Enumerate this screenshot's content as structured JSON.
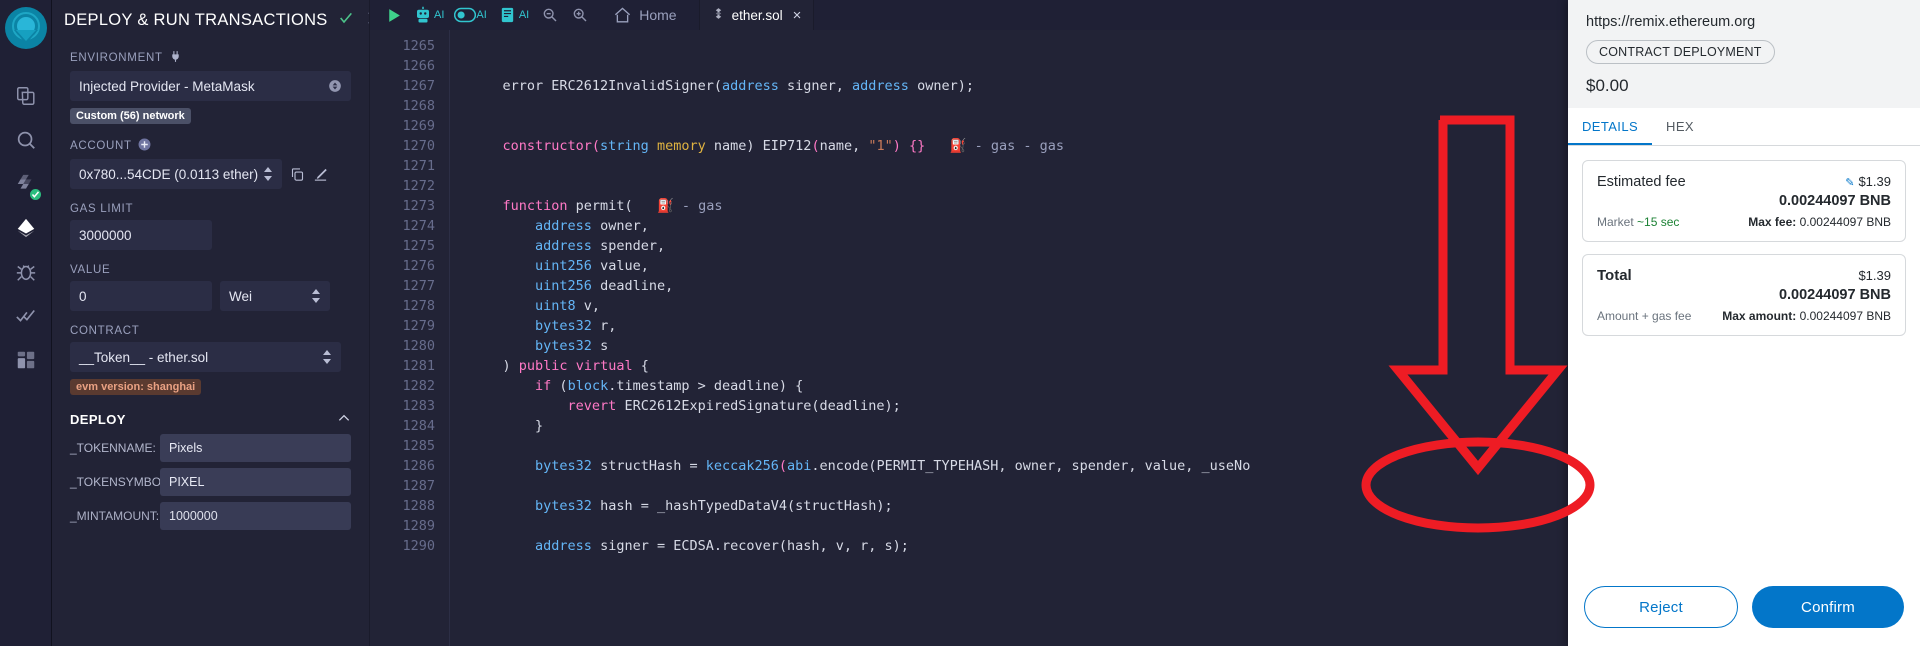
{
  "iconbar": {
    "items": [
      {
        "name": "remix-logo",
        "label": "Remix"
      },
      {
        "name": "file-explorer-icon",
        "label": "File explorer"
      },
      {
        "name": "search-icon",
        "label": "Search in files"
      },
      {
        "name": "solidity-compiler-icon",
        "label": "Solidity compiler"
      },
      {
        "name": "deploy-run-icon",
        "label": "Deploy & run transactions"
      },
      {
        "name": "debugger-icon",
        "label": "Debugger"
      },
      {
        "name": "solidity-unit-testing-icon",
        "label": "Solidity unit testing"
      },
      {
        "name": "plugin-manager-icon",
        "label": "Plugin manager"
      }
    ]
  },
  "panel": {
    "title": "DEPLOY & RUN TRANSACTIONS",
    "environment_label": "ENVIRONMENT",
    "environment_value": "Injected Provider - MetaMask",
    "network_badge": "Custom (56) network",
    "account_label": "ACCOUNT",
    "account_value": "0x780...54CDE (0.0113 ether)",
    "gas_limit_label": "GAS LIMIT",
    "gas_limit_value": "3000000",
    "value_label": "VALUE",
    "value_value": "0",
    "value_unit": "Wei",
    "contract_label": "CONTRACT",
    "contract_value": "__Token__ - ether.sol",
    "evm_badge": "evm version: shanghai",
    "deploy_label": "DEPLOY",
    "args": [
      {
        "label": "_TOKENNAME:",
        "value": "Pixels"
      },
      {
        "label": "_TOKENSYMBOL:",
        "value": "PIXEL"
      },
      {
        "label": "_MINTAMOUNT:",
        "value": "1000000"
      }
    ]
  },
  "toolbar": {
    "check_icon": "check-icon",
    "chevron_icon": "chevron-right-icon",
    "run_label": "",
    "ai_label": "AI",
    "home_label": "Home",
    "zoom_out_label": "",
    "zoom_in_label": ""
  },
  "tab": {
    "filename": "ether.sol",
    "close": "×"
  },
  "editor": {
    "first_line": 1265,
    "lines": [
      {
        "n": 1265,
        "tokens": []
      },
      {
        "n": 1266,
        "tokens": []
      },
      {
        "n": 1267,
        "tokens": [
          {
            "t": "    error ERC2612InvalidSigner(",
            "c": "w"
          },
          {
            "t": "address",
            "c": "t"
          },
          {
            "t": " signer, ",
            "c": "w"
          },
          {
            "t": "address",
            "c": "t"
          },
          {
            "t": " owner);",
            "c": "w"
          }
        ]
      },
      {
        "n": 1268,
        "tokens": []
      },
      {
        "n": 1269,
        "tokens": []
      },
      {
        "n": 1270,
        "tokens": [
          {
            "t": "    constructor(",
            "c": "k"
          },
          {
            "t": "string",
            "c": "t"
          },
          {
            "t": " ",
            "c": "w"
          },
          {
            "t": "memory",
            "c": "y"
          },
          {
            "t": " name) ",
            "c": "w"
          },
          {
            "t": "EIP712",
            "c": "w"
          },
          {
            "t": "(",
            "c": "p"
          },
          {
            "t": "name, ",
            "c": "w"
          },
          {
            "t": "\"1\"",
            "c": "s"
          },
          {
            "t": ") {}",
            "c": "p"
          },
          {
            "t": "   ⛽ - gas - gas",
            "c": "g"
          }
        ]
      },
      {
        "n": 1271,
        "tokens": []
      },
      {
        "n": 1272,
        "tokens": []
      },
      {
        "n": 1273,
        "tokens": [
          {
            "t": "    function",
            "c": "k"
          },
          {
            "t": " permit(",
            "c": "w"
          },
          {
            "t": "   ⛽ - gas",
            "c": "g"
          }
        ]
      },
      {
        "n": 1274,
        "tokens": [
          {
            "t": "        ",
            "c": "w"
          },
          {
            "t": "address",
            "c": "t"
          },
          {
            "t": " owner,",
            "c": "w"
          }
        ]
      },
      {
        "n": 1275,
        "tokens": [
          {
            "t": "        ",
            "c": "w"
          },
          {
            "t": "address",
            "c": "t"
          },
          {
            "t": " spender,",
            "c": "w"
          }
        ]
      },
      {
        "n": 1276,
        "tokens": [
          {
            "t": "        ",
            "c": "w"
          },
          {
            "t": "uint256",
            "c": "t"
          },
          {
            "t": " value,",
            "c": "w"
          }
        ]
      },
      {
        "n": 1277,
        "tokens": [
          {
            "t": "        ",
            "c": "w"
          },
          {
            "t": "uint256",
            "c": "t"
          },
          {
            "t": " deadline,",
            "c": "w"
          }
        ]
      },
      {
        "n": 1278,
        "tokens": [
          {
            "t": "        ",
            "c": "w"
          },
          {
            "t": "uint8",
            "c": "t"
          },
          {
            "t": " v,",
            "c": "w"
          }
        ]
      },
      {
        "n": 1279,
        "tokens": [
          {
            "t": "        ",
            "c": "w"
          },
          {
            "t": "bytes32",
            "c": "t"
          },
          {
            "t": " r,",
            "c": "w"
          }
        ]
      },
      {
        "n": 1280,
        "tokens": [
          {
            "t": "        ",
            "c": "w"
          },
          {
            "t": "bytes32",
            "c": "t"
          },
          {
            "t": " s",
            "c": "w"
          }
        ]
      },
      {
        "n": 1281,
        "tokens": [
          {
            "t": "    ) ",
            "c": "w"
          },
          {
            "t": "public",
            "c": "k"
          },
          {
            "t": " ",
            "c": "w"
          },
          {
            "t": "virtual",
            "c": "k"
          },
          {
            "t": " {",
            "c": "w"
          }
        ]
      },
      {
        "n": 1282,
        "tokens": [
          {
            "t": "        ",
            "c": "w"
          },
          {
            "t": "if",
            "c": "k"
          },
          {
            "t": " (",
            "c": "w"
          },
          {
            "t": "block",
            "c": "t"
          },
          {
            "t": ".timestamp > deadline) {",
            "c": "w"
          }
        ]
      },
      {
        "n": 1283,
        "tokens": [
          {
            "t": "            ",
            "c": "w"
          },
          {
            "t": "revert",
            "c": "k"
          },
          {
            "t": " ERC2612ExpiredSignature(deadline);",
            "c": "w"
          }
        ]
      },
      {
        "n": 1284,
        "tokens": [
          {
            "t": "        }",
            "c": "w"
          }
        ]
      },
      {
        "n": 1285,
        "tokens": []
      },
      {
        "n": 1286,
        "tokens": [
          {
            "t": "        ",
            "c": "w"
          },
          {
            "t": "bytes32",
            "c": "t"
          },
          {
            "t": " structHash = ",
            "c": "w"
          },
          {
            "t": "keccak256",
            "c": "t"
          },
          {
            "t": "(",
            "c": "p"
          },
          {
            "t": "abi",
            "c": "t"
          },
          {
            "t": ".encode(PERMIT_TYPEHASH, owner, spender, value, _useNo",
            "c": "w"
          }
        ]
      },
      {
        "n": 1287,
        "tokens": []
      },
      {
        "n": 1288,
        "tokens": [
          {
            "t": "        ",
            "c": "w"
          },
          {
            "t": "bytes32",
            "c": "t"
          },
          {
            "t": " hash = _hashTypedDataV4(structHash);",
            "c": "w"
          }
        ]
      },
      {
        "n": 1289,
        "tokens": []
      },
      {
        "n": 1290,
        "tokens": [
          {
            "t": "        ",
            "c": "w"
          },
          {
            "t": "address",
            "c": "t"
          },
          {
            "t": " signer = ECDSA.recover(hash, v, r, s);",
            "c": "w"
          }
        ]
      }
    ]
  },
  "metamask": {
    "url": "https://remix.ethereum.org",
    "contract_type_badge": "CONTRACT DEPLOYMENT",
    "amount": "$0.00",
    "tabs": [
      {
        "label": "DETAILS",
        "selected": true
      },
      {
        "label": "HEX",
        "selected": false
      }
    ],
    "fee": {
      "label": "Estimated fee",
      "fiat": "$1.39",
      "native": "0.00244097 BNB",
      "market_label": "Market",
      "market_speed": "~15 sec",
      "max_fee_label": "Max fee:",
      "max_fee_value": "0.00244097 BNB"
    },
    "total": {
      "label": "Total",
      "fiat": "$1.39",
      "native": "0.00244097 BNB",
      "sub_label": "Amount + gas fee",
      "max_label": "Max amount:",
      "max_value": "0.00244097 BNB"
    },
    "reject_label": "Reject",
    "confirm_label": "Confirm"
  },
  "annotation": {
    "color": "#ee1c24",
    "target": "confirm-button"
  }
}
